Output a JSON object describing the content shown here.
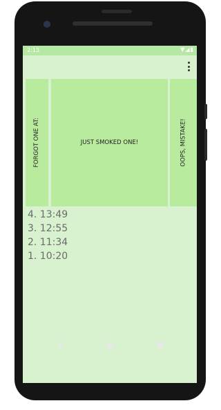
{
  "status_bar": {
    "time": "2:13",
    "icons": "▼◢▮"
  },
  "buttons": {
    "forgot": "FORGOT ONE AT:",
    "smoked": "JUST SMOKED ONE!",
    "oops": "OOPS, MISTAKE!"
  },
  "history": [
    {
      "entry": "4. 13:49"
    },
    {
      "entry": "3. 12:55"
    },
    {
      "entry": "2. 11:34"
    },
    {
      "entry": "1. 10:20"
    }
  ],
  "colors": {
    "background": "#d8f2cf",
    "button": "#b9eb9f",
    "status_bar": "#b5e8a2",
    "text_muted": "#6b6b6b"
  },
  "icons": {
    "menu": "overflow-menu-icon",
    "back": "back-icon",
    "home": "home-icon",
    "recents": "recents-icon"
  }
}
